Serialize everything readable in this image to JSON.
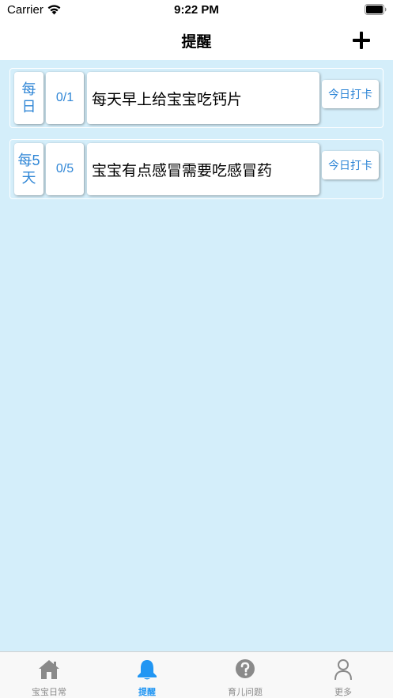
{
  "status_bar": {
    "carrier": "Carrier",
    "time": "9:22 PM"
  },
  "nav": {
    "title": "提醒",
    "add_icon": "plus-icon"
  },
  "reminders": [
    {
      "frequency": "每日",
      "progress": "0/1",
      "task": "每天早上给宝宝吃钙片",
      "checkin_label": "今日打卡"
    },
    {
      "frequency": "每5天",
      "progress": "0/5",
      "task": "宝宝有点感冒需要吃感冒药",
      "checkin_label": "今日打卡"
    }
  ],
  "tabs": [
    {
      "label": "宝宝日常",
      "icon": "house-icon",
      "active": false
    },
    {
      "label": "提醒",
      "icon": "bell-icon",
      "active": true
    },
    {
      "label": "育儿问题",
      "icon": "question-icon",
      "active": false
    },
    {
      "label": "更多",
      "icon": "person-icon",
      "active": false
    }
  ],
  "colors": {
    "accent": "#2f86d6",
    "content_bg": "#d4eefa",
    "tab_active": "#2196f3",
    "tab_inactive": "#8a8a8a"
  }
}
